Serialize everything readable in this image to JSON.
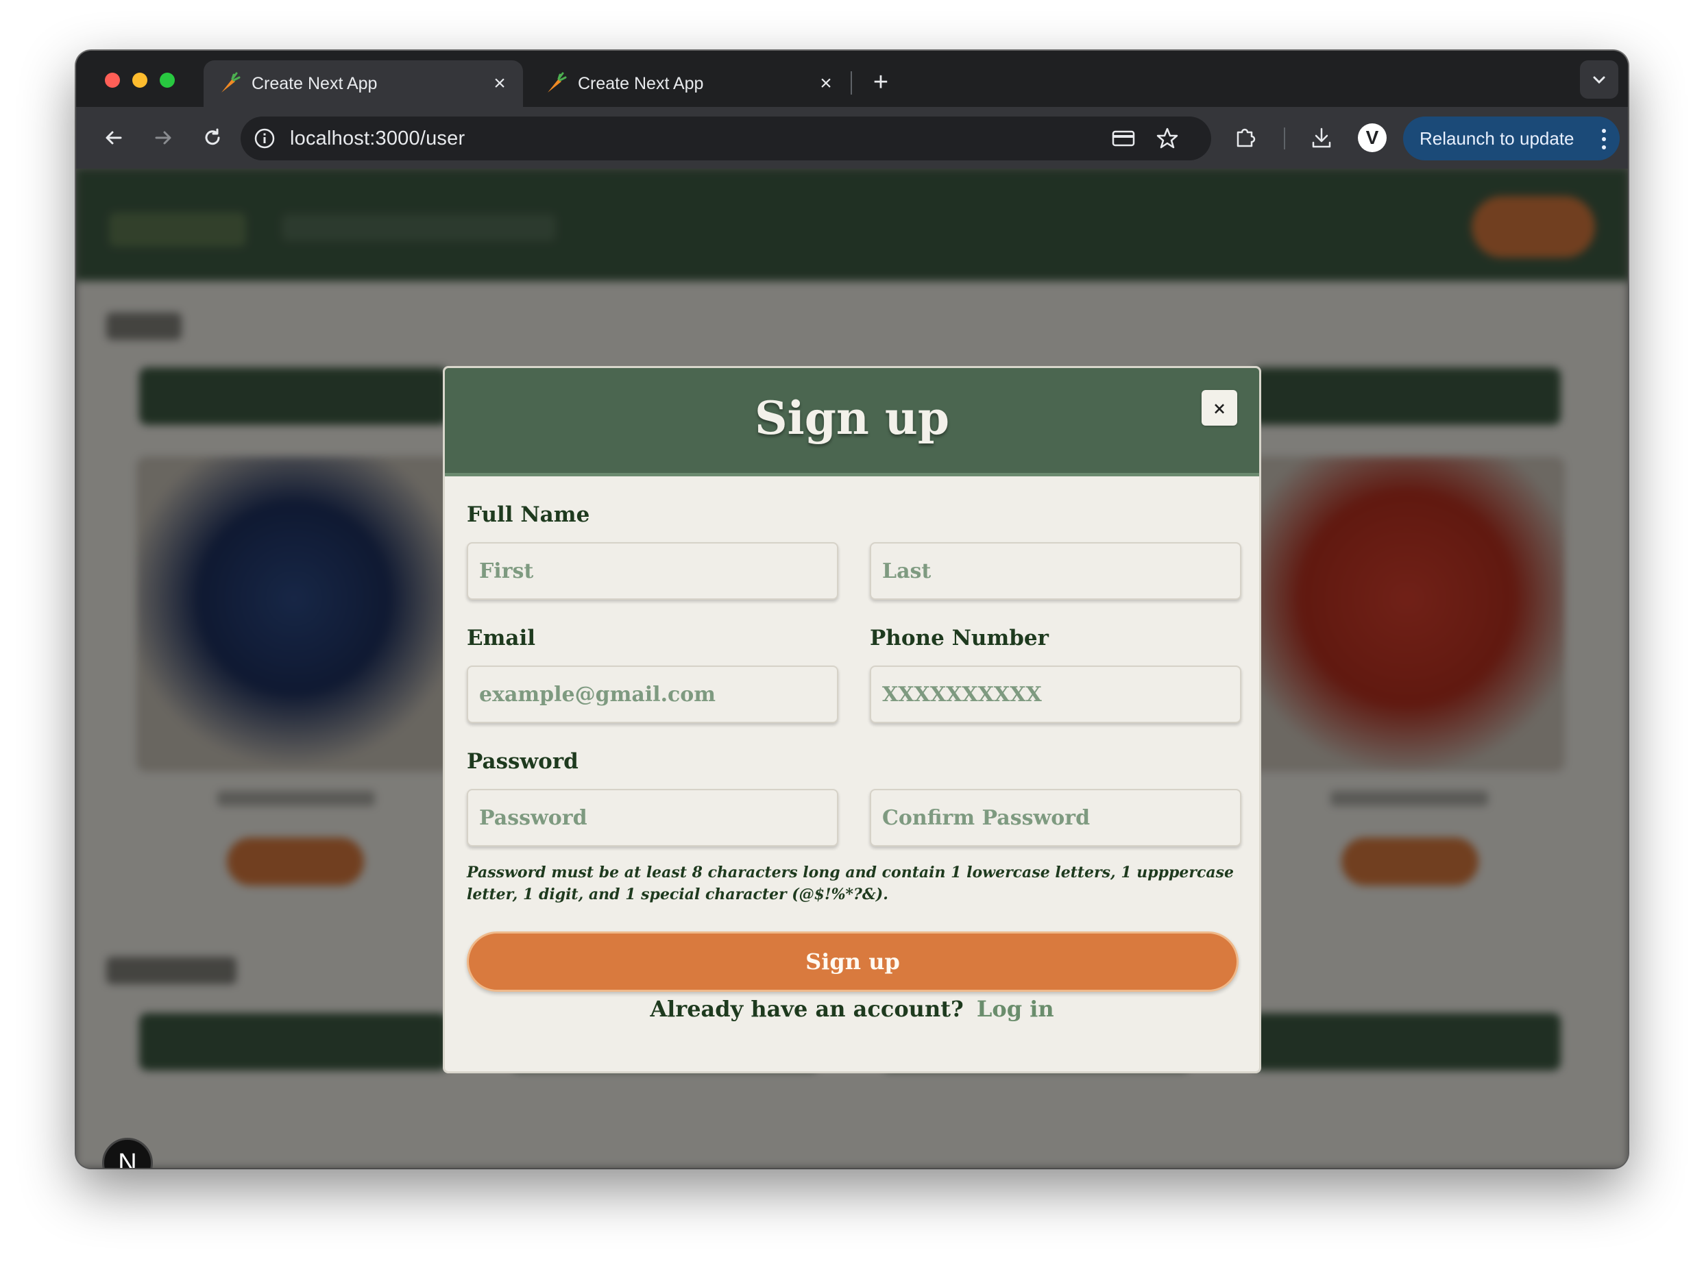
{
  "browser": {
    "tabs": [
      {
        "title": "Create Next App",
        "active": true,
        "favicon": "carrot-icon"
      },
      {
        "title": "Create Next App",
        "active": false,
        "favicon": "carrot-icon"
      }
    ],
    "url": "localhost:3000/user",
    "profile_initial": "V",
    "relaunch_label": "Relaunch to update"
  },
  "modal": {
    "title": "Sign up",
    "close_label": "×",
    "full_name_label": "Full Name",
    "first_placeholder": "First",
    "last_placeholder": "Last",
    "email_label": "Email",
    "email_placeholder": "example@gmail.com",
    "phone_label": "Phone Number",
    "phone_placeholder": "XXXXXXXXXX",
    "password_label": "Password",
    "password_placeholder": "Password",
    "confirm_placeholder": "Confirm Password",
    "password_hint": "Password must be at least 8 characters long and contain 1 lowercase letters, 1 upppercase letter, 1 digit, and 1 special character (@$!%*?&).",
    "submit_label": "Sign up",
    "login_prompt": "Already have an account?",
    "login_link": "Log in"
  },
  "dev_badge": "N",
  "colors": {
    "modal_header": "#4b6650",
    "primary_button": "#d97a3e",
    "text_dark_green": "#1e3a1e",
    "link_green": "#6a8d6c",
    "relaunch_bg": "#1b4a78"
  }
}
